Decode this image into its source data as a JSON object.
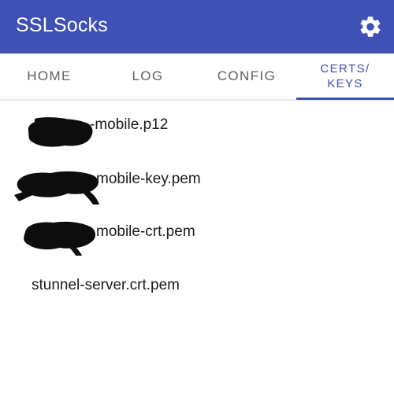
{
  "app_bar": {
    "title": "SSLSocks",
    "settings_icon": "gear-icon",
    "background": "#3f51b5"
  },
  "tabs": [
    {
      "label": "HOME",
      "active": false
    },
    {
      "label": "LOG",
      "active": false
    },
    {
      "label": "CONFIG",
      "active": false
    },
    {
      "label_line1": "CERTS/",
      "label_line2": "KEYS",
      "active": true
    }
  ],
  "files": [
    {
      "visible_name": "-mobile.p12",
      "redacted_prefix": true
    },
    {
      "visible_name": "mobile-key.pem",
      "redacted_prefix": true
    },
    {
      "visible_name": "mobile-crt.pem",
      "redacted_prefix": true
    },
    {
      "visible_name": "stunnel-server.crt.pem",
      "redacted_prefix": false
    }
  ],
  "colors": {
    "accent": "#3f51b5",
    "tab_inactive": "#5f5f5f",
    "text": "#1a1a1a",
    "redaction": "#0d0d0d"
  }
}
